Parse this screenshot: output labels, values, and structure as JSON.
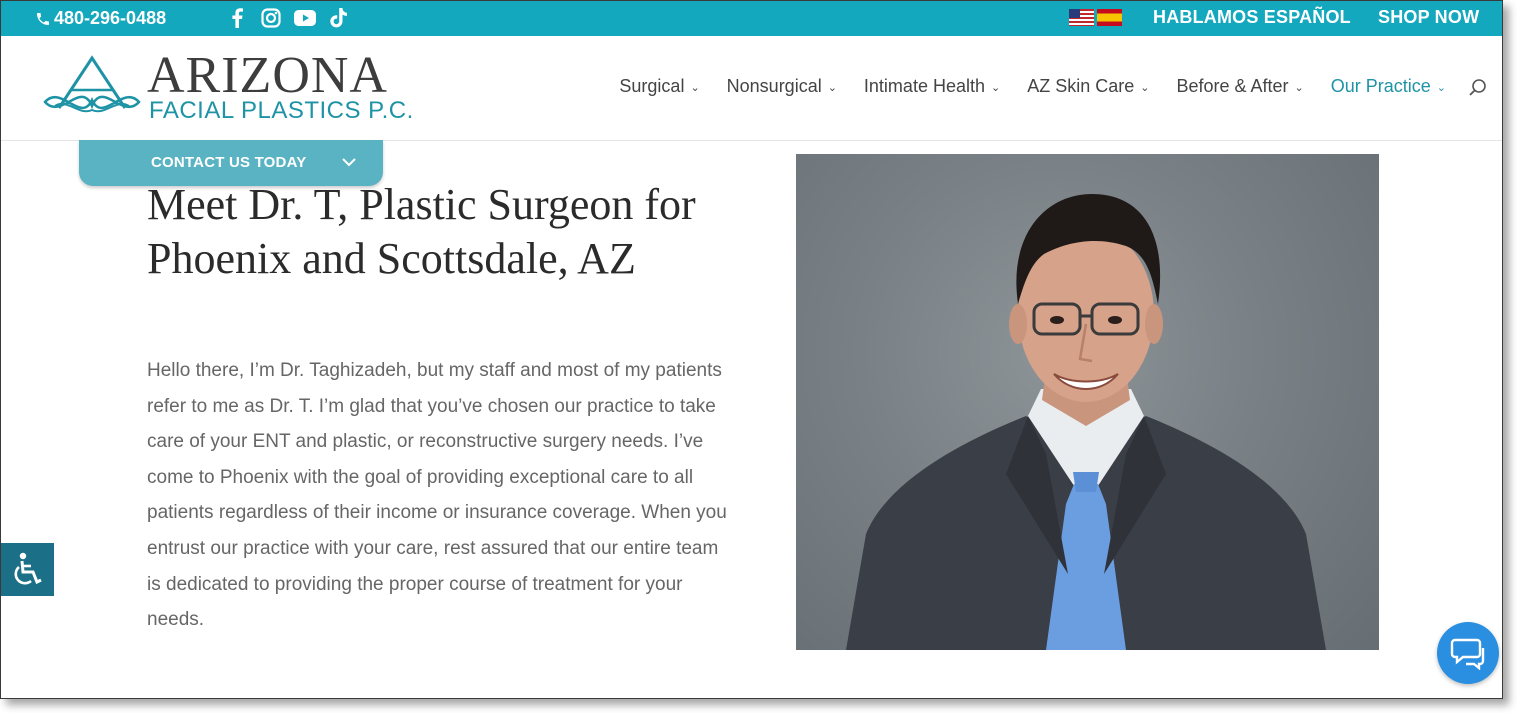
{
  "topbar": {
    "phone": "480-296-0488",
    "social_icons": [
      "facebook-icon",
      "instagram-icon",
      "youtube-icon",
      "tiktok-icon"
    ],
    "language_link": "HABLAMOS ESPAÑOL",
    "shop_link": "SHOP NOW"
  },
  "logo": {
    "title": "ARIZONA",
    "subtitle": "FACIAL PLASTICS P.C."
  },
  "nav": {
    "items": [
      {
        "label": "Surgical"
      },
      {
        "label": "Nonsurgical"
      },
      {
        "label": "Intimate Health"
      },
      {
        "label": "AZ Skin Care"
      },
      {
        "label": "Before & After"
      },
      {
        "label": "Our Practice"
      }
    ]
  },
  "contact": {
    "label": "CONTACT US TODAY"
  },
  "content": {
    "heading": "Meet Dr. T, Plastic Surgeon for Phoenix and Scottsdale, AZ",
    "body": "Hello there, I’m Dr. Taghizadeh, but my staff and most of my patients refer to me as Dr. T. I’m glad that you’ve chosen our practice to take care of your ENT and plastic, or reconstructive surgery needs. I’ve come to Phoenix with the goal of providing exceptional care to all patients regardless of their income or insurance coverage. When you entrust our practice with your care, rest assured that our entire team is dedicated to providing the proper course of treatment for your needs."
  },
  "colors": {
    "brand_teal": "#14a8be",
    "accent_teal": "#1f93a6",
    "contact_tab": "#5ab3c3",
    "chat_blue": "#2a8fe0",
    "accessibility": "#1b6f87"
  }
}
